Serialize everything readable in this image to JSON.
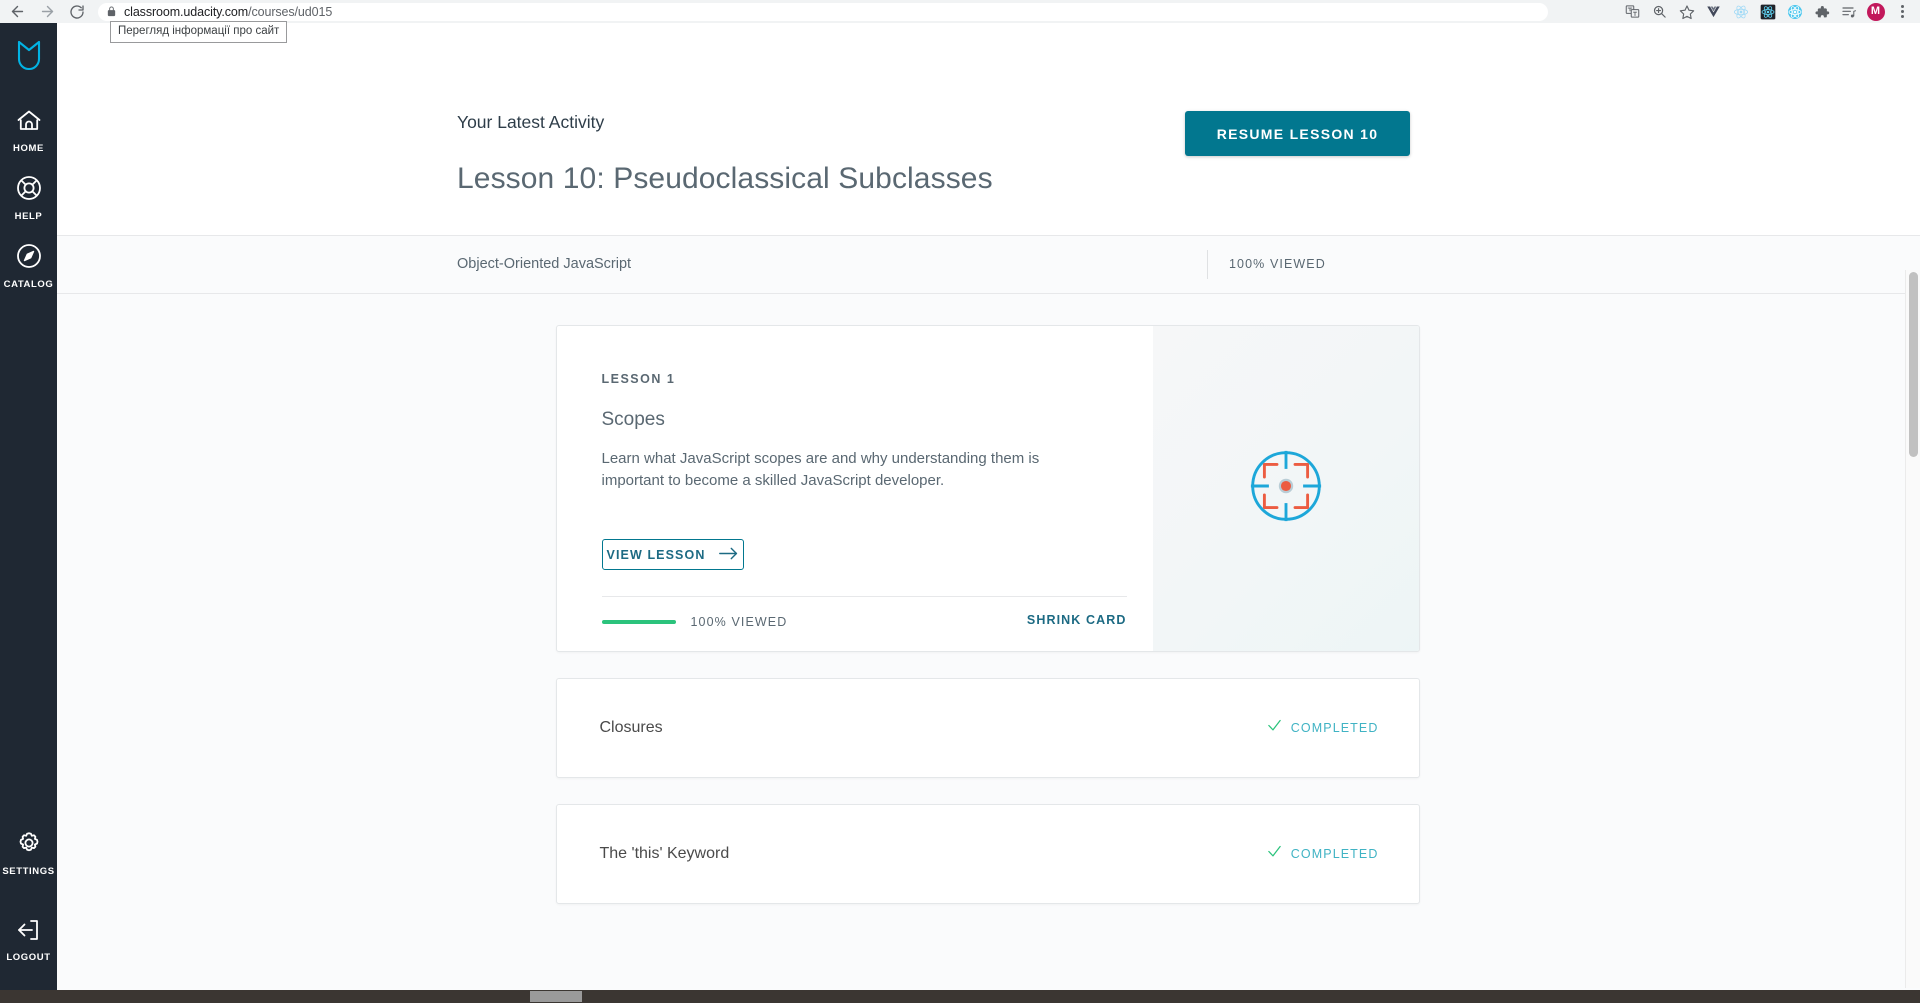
{
  "browser": {
    "back_icon": "back-arrow-icon",
    "forward_icon": "forward-arrow-icon",
    "reload_icon": "reload-icon",
    "lock_icon": "lock-icon",
    "url_domain": "classroom.udacity.com",
    "url_path": "/courses/ud015",
    "url_full": "classroom.udacity.com/courses/ud015",
    "tooltip": "Перегляд інформації про сайт",
    "toolbar_icons": [
      {
        "name": "translate-icon",
        "glyph": "translate"
      },
      {
        "name": "zoom-search-icon",
        "glyph": "zoom"
      },
      {
        "name": "bookmark-star-icon",
        "glyph": "star"
      },
      {
        "name": "vue-devtools-icon",
        "glyph": "vue"
      },
      {
        "name": "react-devtools-icon",
        "glyph": "react-light"
      },
      {
        "name": "react-devtools-dark-icon",
        "glyph": "react-dark"
      },
      {
        "name": "atom-extension-icon",
        "glyph": "react-cyan"
      },
      {
        "name": "extensions-puzzle-icon",
        "glyph": "puzzle"
      },
      {
        "name": "reading-list-icon",
        "glyph": "readinglist"
      }
    ],
    "avatar_initial": "M",
    "menu_icon": "kebab-menu-icon"
  },
  "sidebar": {
    "logo_name": "udacity-logo",
    "items": [
      {
        "label": "HOME",
        "icon": "home-icon"
      },
      {
        "label": "HELP",
        "icon": "life-preserver-icon"
      },
      {
        "label": "CATALOG",
        "icon": "compass-icon"
      }
    ],
    "bottom_items": [
      {
        "label": "SETTINGS",
        "icon": "gear-icon"
      },
      {
        "label": "LOGOUT",
        "icon": "logout-icon"
      }
    ]
  },
  "header": {
    "activity_label": "Your Latest Activity",
    "activity_title": "Lesson 10: Pseudoclassical Subclasses",
    "resume_button": "RESUME LESSON 10"
  },
  "course_bar": {
    "course_name": "Object-Oriented JavaScript",
    "viewed": "100% VIEWED"
  },
  "lesson_card": {
    "lesson_number": "LESSON 1",
    "title": "Scopes",
    "description": "Learn what JavaScript scopes are and why understanding them is important to become a skilled JavaScript developer.",
    "view_button": "VIEW LESSON",
    "arrow_icon": "arrow-right-icon",
    "progress_label": "100% VIEWED",
    "progress_percent": 100,
    "shrink_link": "SHRINK CARD",
    "illustration": "target-crosshair-icon"
  },
  "lesson_rows": [
    {
      "title": "Closures",
      "status": "COMPLETED",
      "status_icon": "check-icon"
    },
    {
      "title": "The 'this' Keyword",
      "status": "COMPLETED",
      "status_icon": "check-icon"
    }
  ],
  "colors": {
    "sidebar_bg": "#1f2833",
    "brand_teal": "#02778f",
    "link_teal": "#1c6a83",
    "progress_green": "#2bc37c",
    "status_cyan": "#40b3c4",
    "page_bg": "#fafbfc",
    "avatar_bg": "#c2185b"
  }
}
